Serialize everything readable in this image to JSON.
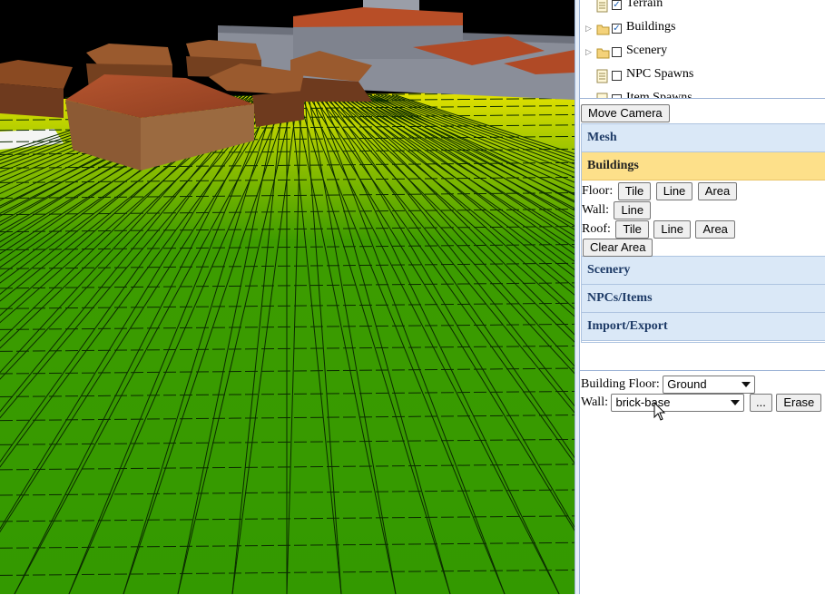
{
  "layers": [
    {
      "label": "Terrain",
      "checked": true,
      "expandable": false,
      "icon": "page-icon"
    },
    {
      "label": "Buildings",
      "checked": true,
      "expandable": true,
      "icon": "folder-icon"
    },
    {
      "label": "Scenery",
      "checked": false,
      "expandable": true,
      "icon": "folder-icon"
    },
    {
      "label": "NPC Spawns",
      "checked": false,
      "expandable": false,
      "icon": "page-icon"
    },
    {
      "label": "Item Spawns",
      "checked": false,
      "expandable": false,
      "icon": "page-icon"
    }
  ],
  "toolbar": {
    "move_camera": "Move Camera"
  },
  "accordion": {
    "mesh": "Mesh",
    "buildings": "Buildings",
    "scenery": "Scenery",
    "npcs_items": "NPCs/Items",
    "import_export": "Import/Export"
  },
  "buildings": {
    "floor_label": "Floor:",
    "wall_label": "Wall:",
    "roof_label": "Roof:",
    "tile": "Tile",
    "line": "Line",
    "area": "Area",
    "clear_area": "Clear Area"
  },
  "props": {
    "building_floor_label": "Building Floor:",
    "building_floor_value": "Ground",
    "wall_label": "Wall:",
    "wall_value": "brick-base",
    "browse": "...",
    "erase": "Erase"
  },
  "colors": {
    "grass": "#339900",
    "accent_active": "#fde08a",
    "header_bg": "#dae8f7"
  }
}
